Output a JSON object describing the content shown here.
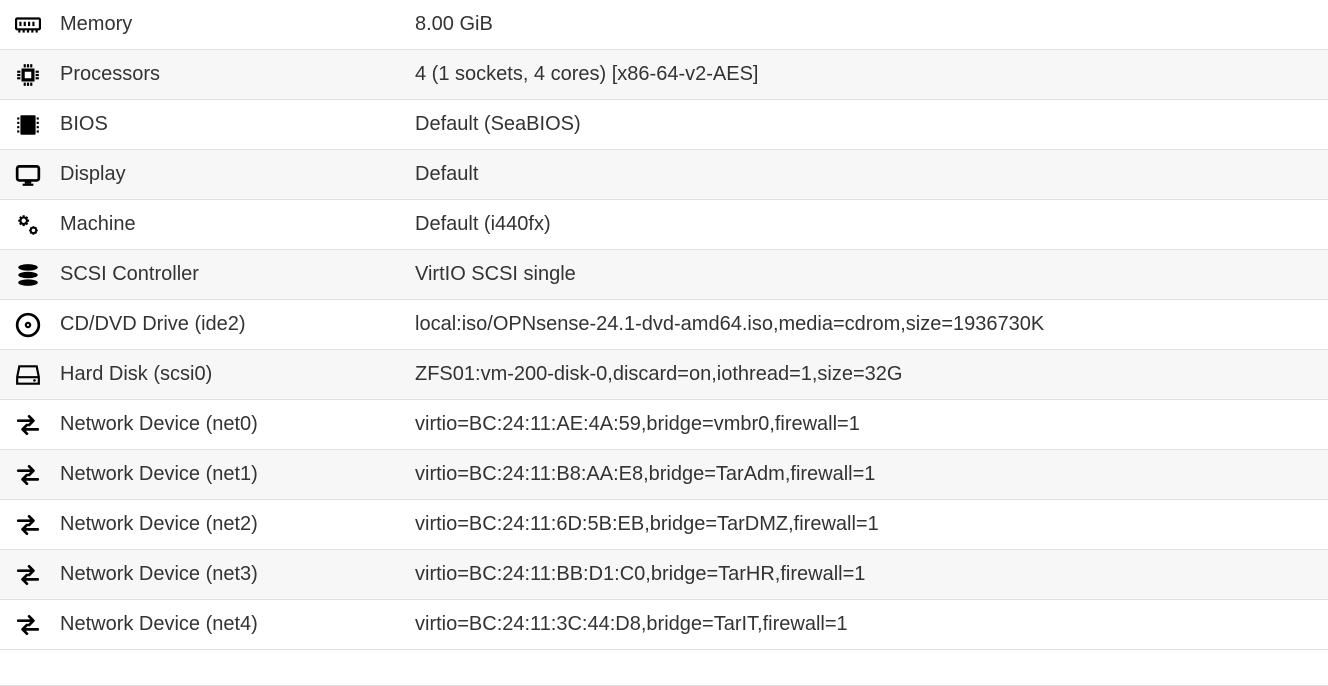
{
  "rows": [
    {
      "icon": "memory-icon",
      "label": "Memory",
      "value": "8.00 GiB"
    },
    {
      "icon": "cpu-icon",
      "label": "Processors",
      "value": "4 (1 sockets, 4 cores) [x86-64-v2-AES]"
    },
    {
      "icon": "bios-icon",
      "label": "BIOS",
      "value": "Default (SeaBIOS)"
    },
    {
      "icon": "display-icon",
      "label": "Display",
      "value": "Default"
    },
    {
      "icon": "gears-icon",
      "label": "Machine",
      "value": "Default (i440fx)"
    },
    {
      "icon": "storage-icon",
      "label": "SCSI Controller",
      "value": "VirtIO SCSI single"
    },
    {
      "icon": "disc-icon",
      "label": "CD/DVD Drive (ide2)",
      "value": "local:iso/OPNsense-24.1-dvd-amd64.iso,media=cdrom,size=1936730K"
    },
    {
      "icon": "hdd-icon",
      "label": "Hard Disk (scsi0)",
      "value": "ZFS01:vm-200-disk-0,discard=on,iothread=1,size=32G"
    },
    {
      "icon": "network-icon",
      "label": "Network Device (net0)",
      "value": "virtio=BC:24:11:AE:4A:59,bridge=vmbr0,firewall=1"
    },
    {
      "icon": "network-icon",
      "label": "Network Device (net1)",
      "value": "virtio=BC:24:11:B8:AA:E8,bridge=TarAdm,firewall=1"
    },
    {
      "icon": "network-icon",
      "label": "Network Device (net2)",
      "value": "virtio=BC:24:11:6D:5B:EB,bridge=TarDMZ,firewall=1"
    },
    {
      "icon": "network-icon",
      "label": "Network Device (net3)",
      "value": "virtio=BC:24:11:BB:D1:C0,bridge=TarHR,firewall=1"
    },
    {
      "icon": "network-icon",
      "label": "Network Device (net4)",
      "value": "virtio=BC:24:11:3C:44:D8,bridge=TarIT,firewall=1"
    }
  ]
}
